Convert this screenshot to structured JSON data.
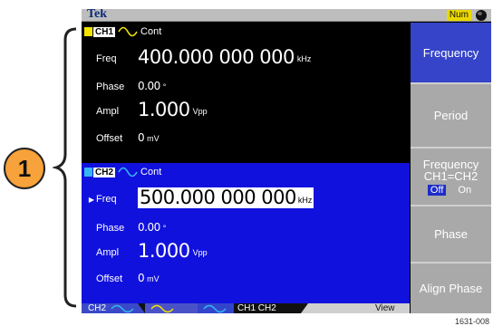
{
  "callout": {
    "number": "1"
  },
  "figure_id": "1631-008",
  "status_bar": {
    "brand": "Tek",
    "num_indicator": "Num",
    "icon": "globe-icon"
  },
  "ch1": {
    "tag": "CH1",
    "color": "#f2e400",
    "mode": "Cont",
    "rows": [
      {
        "label": "Freq",
        "value": "400.000 000 000",
        "unit": "kHz"
      },
      {
        "label": "Phase",
        "value": "0.00",
        "unit": "°"
      },
      {
        "label": "Ampl",
        "value": "1.000",
        "unit": "Vpp"
      },
      {
        "label": "Offset",
        "value": "0",
        "unit": "mV"
      }
    ]
  },
  "ch2": {
    "tag": "CH2",
    "color": "#35b6f2",
    "mode": "Cont",
    "rows": [
      {
        "label": "Freq",
        "value": "500.000 000 000",
        "unit": "kHz",
        "selected": true
      },
      {
        "label": "Phase",
        "value": "0.00",
        "unit": "°"
      },
      {
        "label": "Ampl",
        "value": "1.000",
        "unit": "Vpp"
      },
      {
        "label": "Offset",
        "value": "0",
        "unit": "mV"
      }
    ]
  },
  "tab_bar": {
    "ch2_tab": "CH2",
    "ch_tabs": "CH1   CH2",
    "view_tab": "View"
  },
  "softkeys": {
    "frequency": "Frequency",
    "period": "Period",
    "freq_ch_line1": "Frequency",
    "freq_ch_line2": "CH1=CH2",
    "toggle_off": "Off",
    "toggle_on": "On",
    "phase": "Phase",
    "align_phase": "Align Phase"
  }
}
